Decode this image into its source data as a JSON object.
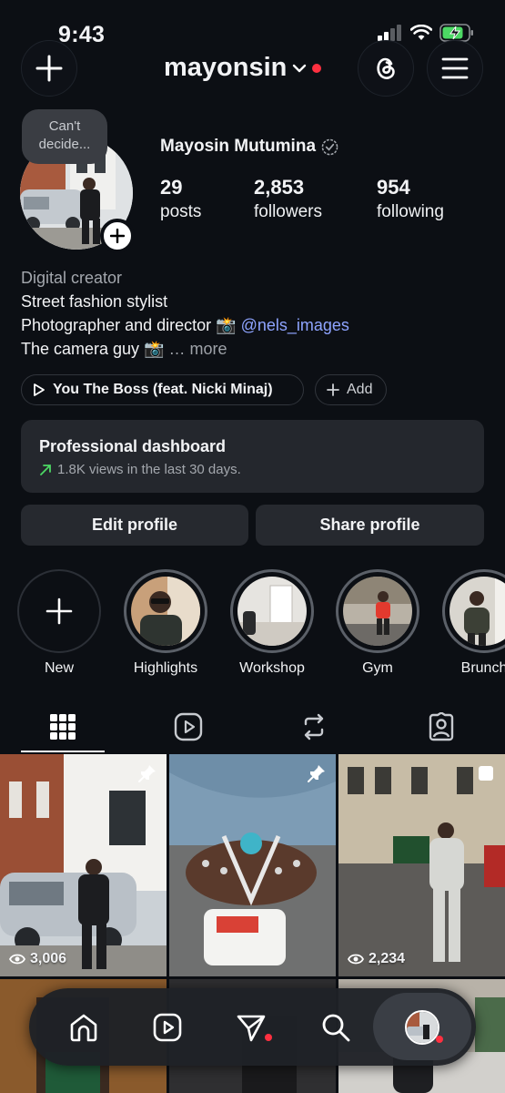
{
  "status_bar": {
    "time": "9:43"
  },
  "header": {
    "username": "mayonsin"
  },
  "note": {
    "text": "Can't decide..."
  },
  "profile": {
    "full_name": "Mayosin Mutumina",
    "stats": [
      {
        "value": "29",
        "label": "posts"
      },
      {
        "value": "2,853",
        "label": "followers"
      },
      {
        "value": "954",
        "label": "following"
      }
    ],
    "category": "Digital creator",
    "bio_line1": "Street fashion stylist",
    "bio_line2_text": "Photographer and director",
    "bio_line2_mention": "@nels_images",
    "bio_line3_text": "The camera guy",
    "bio_more": "more"
  },
  "music_chip": {
    "label": "You The Boss (feat. Nicki Minaj)"
  },
  "add_chip": {
    "label": "Add"
  },
  "dashboard": {
    "title": "Professional dashboard",
    "subtitle": "1.8K views in the last 30 days."
  },
  "buttons": {
    "edit": "Edit profile",
    "share": "Share profile"
  },
  "highlights": [
    {
      "label": "New"
    },
    {
      "label": "Highlights"
    },
    {
      "label": "Workshop"
    },
    {
      "label": "Gym"
    },
    {
      "label": "Brunch"
    }
  ],
  "posts": [
    {
      "views": "3,006"
    },
    {
      "views": ""
    },
    {
      "views": "2,234"
    }
  ],
  "colors": {
    "accent_link": "#8ea4ff",
    "notification_red": "#ff3040",
    "trend_green": "#4cd964"
  }
}
